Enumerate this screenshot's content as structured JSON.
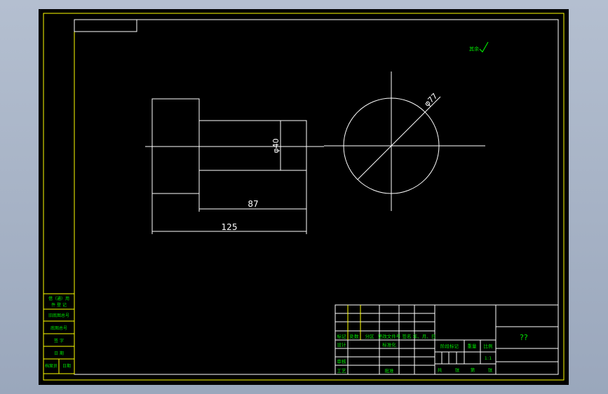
{
  "drawing": {
    "title_code": "??",
    "surface_mark": "其余",
    "dimensions": {
      "length_87": "87",
      "length_125": "125",
      "diameter_40": "φ40",
      "diameter_77": "φ77"
    }
  },
  "side_table": {
    "row1_line1": "借（通）用",
    "row1_line2": "件 登 记",
    "row2": "旧底图总号",
    "row3": "底图总号",
    "row4": "签 字",
    "row5": "日 期",
    "row6_col1": "档案员",
    "row6_col2": "日期"
  },
  "title_block": {
    "header": {
      "mark": "标记",
      "count": "处数",
      "zone": "分区",
      "doc_no": "更改文件号",
      "sign": "签名",
      "date": "年、月、日"
    },
    "design": "设计",
    "standardize": "标准化",
    "review": "审核",
    "process": "工艺",
    "approve": "批准",
    "stage_mark": "阶段标记",
    "weight": "重量",
    "scale": "比例",
    "scale_value": "1:1",
    "sheets_total": "共",
    "sheets_unit1": "张",
    "sheets_no": "第",
    "sheets_unit2": "张"
  }
}
